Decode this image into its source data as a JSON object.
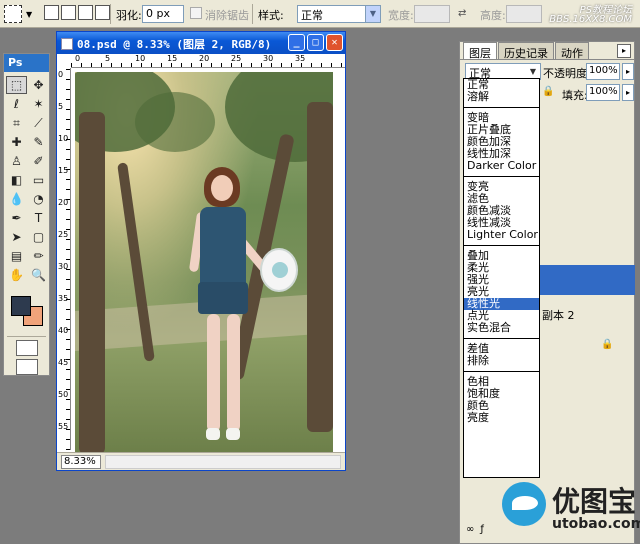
{
  "options_bar": {
    "feather_label": "羽化:",
    "feather_value": "0 px",
    "antialias_label": "消除锯齿",
    "style_label": "样式:",
    "style_value": "正常",
    "width_label": "宽度:",
    "height_label": "高度:"
  },
  "watermark_top": {
    "line1": "PS教程论坛",
    "line2": "BBS.16XX8.COM"
  },
  "toolbox": {
    "logo": "Ps"
  },
  "document": {
    "title": "08.psd @ 8.33% (图层 2, RGB/8)",
    "zoom": "8.33%",
    "ruler_h_ticks": [
      "0",
      "5",
      "10",
      "15",
      "20",
      "25",
      "30",
      "35"
    ],
    "ruler_v_ticks": [
      "0",
      "5",
      "10",
      "15",
      "20",
      "25",
      "30",
      "35",
      "40",
      "45",
      "50",
      "55"
    ]
  },
  "layers_panel": {
    "tabs": [
      "图层",
      "历史记录",
      "动作"
    ],
    "blend_mode": "正常",
    "opacity_label": "不透明度:",
    "opacity_value": "100%",
    "fill_label": "填充:",
    "fill_value": "100%",
    "layer_copy_name": "副本 2"
  },
  "blend_dropdown": {
    "groups": [
      [
        "正常",
        "溶解"
      ],
      [
        "变暗",
        "正片叠底",
        "颜色加深",
        "线性加深",
        "Darker Color"
      ],
      [
        "变亮",
        "滤色",
        "颜色减淡",
        "线性减淡",
        "Lighter Color"
      ],
      [
        "叠加",
        "柔光",
        "强光",
        "亮光",
        "线性光",
        "点光",
        "实色混合"
      ],
      [
        "差值",
        "排除"
      ],
      [
        "色相",
        "饱和度",
        "颜色",
        "亮度"
      ]
    ],
    "highlighted": "线性光"
  },
  "logo": {
    "chinese": "优图宝",
    "english": "utobao.com"
  },
  "colors": {
    "foreground": "#2d3a4e",
    "background": "#f0a37a",
    "title_blue": "#0a58d6",
    "highlight": "#316ac5"
  }
}
